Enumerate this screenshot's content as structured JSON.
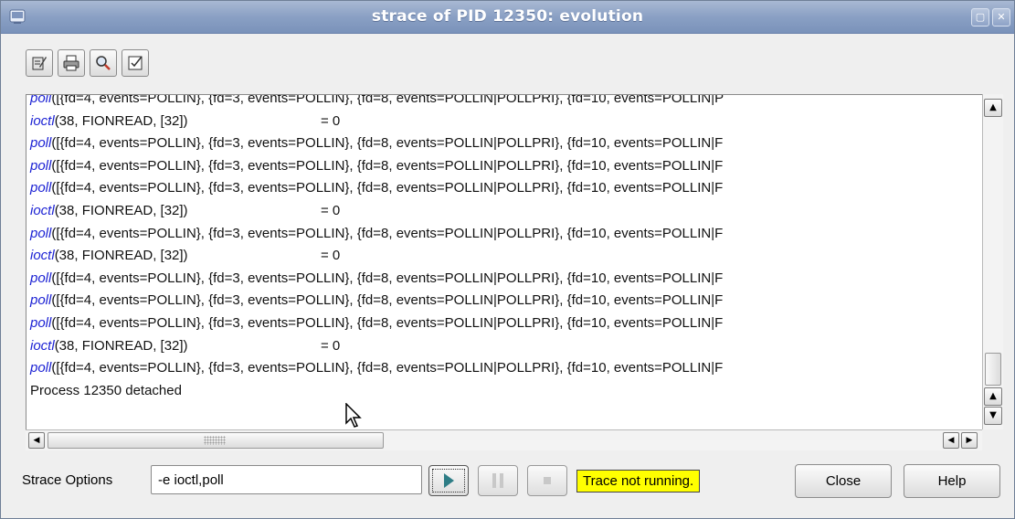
{
  "window": {
    "title": "strace of PID 12350: evolution"
  },
  "toolbar": {
    "buttons": [
      {
        "name": "edit-icon"
      },
      {
        "name": "print-icon"
      },
      {
        "name": "find-icon"
      },
      {
        "name": "clear-icon"
      }
    ]
  },
  "output": {
    "lines": [
      {
        "fn": "poll",
        "args": "([{fd=4, events=POLLIN}, {fd=3, events=POLLIN}, {fd=8, events=POLLIN|POLLPRI}, {fd=10, events=POLLIN|P",
        "ret": ""
      },
      {
        "fn": "ioctl",
        "args": "(38, FIONREAD, [32])",
        "ret": "= 0"
      },
      {
        "fn": "poll",
        "args": "([{fd=4, events=POLLIN}, {fd=3, events=POLLIN}, {fd=8, events=POLLIN|POLLPRI}, {fd=10, events=POLLIN|F",
        "ret": ""
      },
      {
        "fn": "poll",
        "args": "([{fd=4, events=POLLIN}, {fd=3, events=POLLIN}, {fd=8, events=POLLIN|POLLPRI}, {fd=10, events=POLLIN|F",
        "ret": ""
      },
      {
        "fn": "poll",
        "args": "([{fd=4, events=POLLIN}, {fd=3, events=POLLIN}, {fd=8, events=POLLIN|POLLPRI}, {fd=10, events=POLLIN|F",
        "ret": ""
      },
      {
        "fn": "ioctl",
        "args": "(38, FIONREAD, [32])",
        "ret": "= 0"
      },
      {
        "fn": "poll",
        "args": "([{fd=4, events=POLLIN}, {fd=3, events=POLLIN}, {fd=8, events=POLLIN|POLLPRI}, {fd=10, events=POLLIN|F",
        "ret": ""
      },
      {
        "fn": "ioctl",
        "args": "(38, FIONREAD, [32])",
        "ret": "= 0"
      },
      {
        "fn": "poll",
        "args": "([{fd=4, events=POLLIN}, {fd=3, events=POLLIN}, {fd=8, events=POLLIN|POLLPRI}, {fd=10, events=POLLIN|F",
        "ret": ""
      },
      {
        "fn": "poll",
        "args": "([{fd=4, events=POLLIN}, {fd=3, events=POLLIN}, {fd=8, events=POLLIN|POLLPRI}, {fd=10, events=POLLIN|F",
        "ret": ""
      },
      {
        "fn": "poll",
        "args": "([{fd=4, events=POLLIN}, {fd=3, events=POLLIN}, {fd=8, events=POLLIN|POLLPRI}, {fd=10, events=POLLIN|F",
        "ret": ""
      },
      {
        "fn": "ioctl",
        "args": "(38, FIONREAD, [32])",
        "ret": "= 0"
      },
      {
        "fn": "poll",
        "args": "([{fd=4, events=POLLIN}, {fd=3, events=POLLIN}, {fd=8, events=POLLIN|POLLPRI}, {fd=10, events=POLLIN|F",
        "ret": ""
      },
      {
        "fn": "",
        "args": "Process 12350 detached",
        "ret": ""
      }
    ]
  },
  "controls": {
    "options_label": "Strace Options",
    "options_value": "-e ioctl,poll",
    "status_text": "Trace not running.",
    "status_color": "#ffff00",
    "close_label": "Close",
    "help_label": "Help"
  }
}
